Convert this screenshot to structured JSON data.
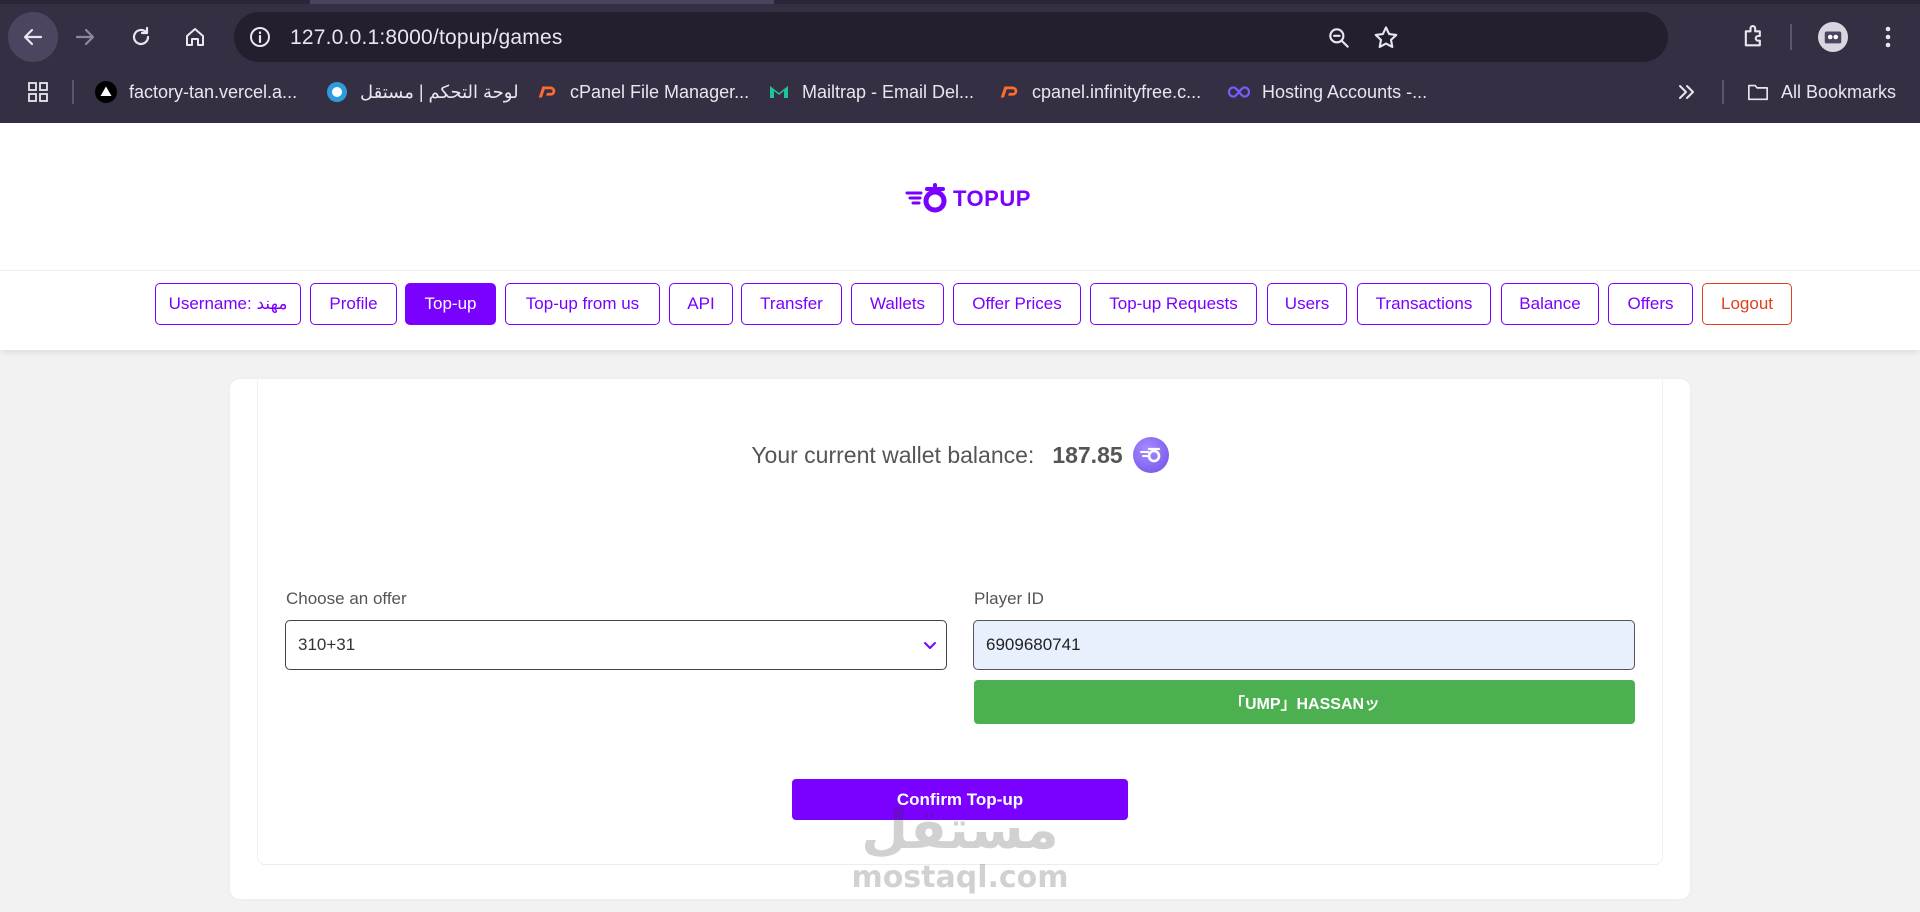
{
  "browser": {
    "url": "127.0.0.1:8000/topup/games",
    "bookmarks": [
      {
        "label": "factory-tan.vercel.a..."
      },
      {
        "label": "لوحة التحكم | مستقل"
      },
      {
        "label": "cPanel File Manager..."
      },
      {
        "label": "Mailtrap - Email Del..."
      },
      {
        "label": "cpanel.infinityfree.c..."
      },
      {
        "label": "Hosting Accounts -..."
      }
    ],
    "all_bookmarks": "All Bookmarks"
  },
  "site": {
    "logo_text": "TOPUP",
    "brand_color": "#7a00ff"
  },
  "nav": {
    "username": "Username: مهند",
    "items": [
      "Profile",
      "Top-up",
      "Top-up from us",
      "API",
      "Transfer",
      "Wallets",
      "Offer Prices",
      "Top-up Requests",
      "Users",
      "Transactions",
      "Balance",
      "Offers"
    ],
    "active": "Top-up",
    "logout": "Logout"
  },
  "wallet": {
    "label": "Your current wallet balance:",
    "amount": "187.85"
  },
  "form": {
    "offer_label": "Choose an offer",
    "offer_value": "310+31",
    "player_label": "Player ID",
    "player_value": "6909680741",
    "player_name": "「UMP」HASSANッ",
    "confirm_label": "Confirm Top-up"
  },
  "watermark": {
    "arabic": "مستقل",
    "latin": "mostaql.com"
  }
}
